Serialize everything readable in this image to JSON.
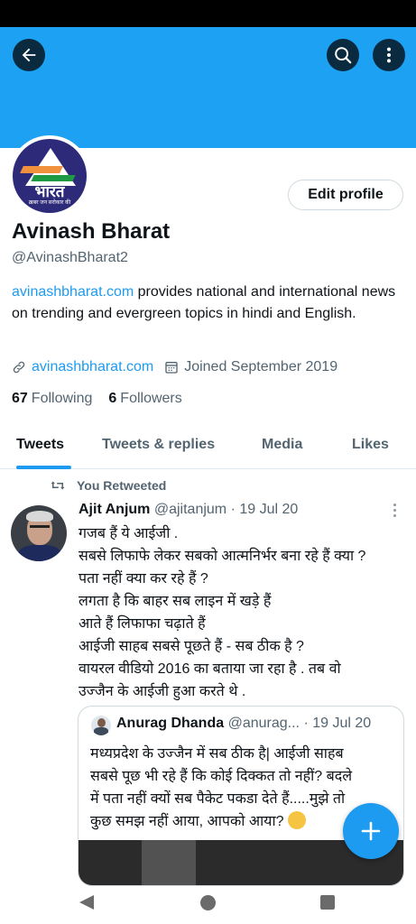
{
  "header": {
    "back_icon": "arrow-left-icon",
    "search_icon": "search-icon",
    "more_icon": "more-vertical-icon",
    "banner_color": "#1da1f2"
  },
  "profile": {
    "avatar_title": "भारत",
    "avatar_tagline": "ख़बर जन सरोकार की",
    "edit_label": "Edit profile",
    "display_name": "Avinash Bharat",
    "handle": "@AvinashBharat2",
    "bio_link": "avinashbharat.com",
    "bio_text": " provides national and international news on trending and evergreen topics in hindi and English.",
    "website": "avinashbharat.com",
    "joined": "Joined September 2019",
    "following_count": "67",
    "following_label": "Following",
    "followers_count": "6",
    "followers_label": "Followers"
  },
  "tabs": [
    {
      "label": "Tweets",
      "active": true
    },
    {
      "label": "Tweets & replies",
      "active": false
    },
    {
      "label": "Media",
      "active": false
    },
    {
      "label": "Likes",
      "active": false
    }
  ],
  "tweet": {
    "retweet_label": "You Retweeted",
    "author_name": "Ajit Anjum",
    "author_handle": "@ajitanjum",
    "date": "· 19 Jul 20",
    "lines": [
      "गजब हैं ये आईजी .",
      "सबसे लिफाफे लेकर सबको आत्मनिर्भर बना रहे हैं क्या ?",
      "पता नहीं क्या कर रहे हैं ?",
      "लगता है कि बाहर सब लाइन में खड़े हैं",
      "आते हैं लिफाफा चढ़ाते हैं",
      "आईजी साहब सबसे पूछते हैं - सब ठीक है ?",
      "वायरल वीडियो 2016 का बताया जा रहा है . तब वो",
      "उज्जैन के आईजी हुआ करते थे ."
    ],
    "quote": {
      "author_name": "Anurag Dhanda",
      "author_handle": "@anurag...",
      "date": "· 19 Jul 20",
      "lines": [
        "मध्यप्रदेश के उज्जैन में सब ठीक है| आईजी साहब",
        "सबसे पूछ भी रहे हैं कि कोई दिक्कत तो नहीं? बदले",
        "में पता नहीं क्यों सब पैकेट पकडा देते हैं.....मुझे तो",
        "कुछ समझ नहीं आया, आपको आया?"
      ],
      "emoji": "thinking-face-icon"
    }
  },
  "fab": {
    "icon": "plus-icon",
    "color": "#1d9bf0"
  },
  "system_nav": {
    "back": "nav-back-icon",
    "home": "nav-home-icon",
    "recents": "nav-recents-icon"
  }
}
